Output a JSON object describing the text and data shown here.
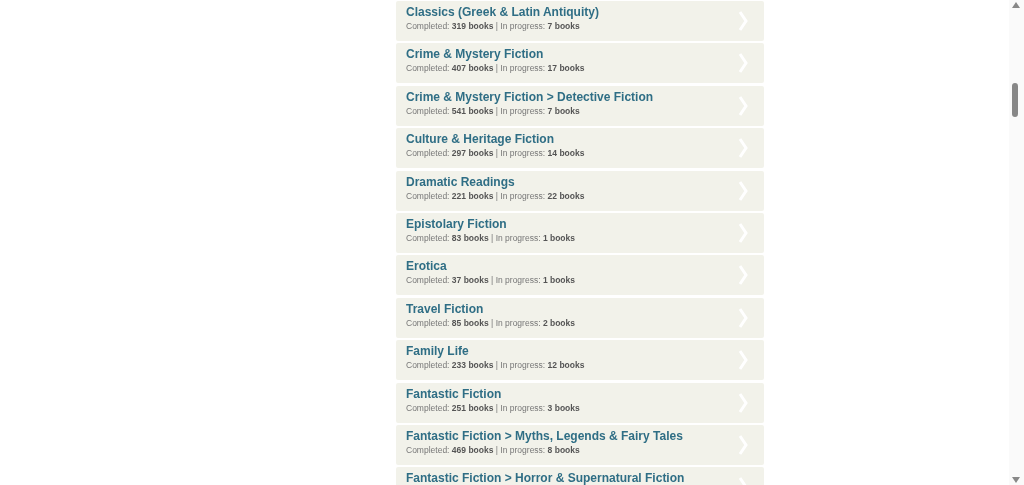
{
  "categories": [
    {
      "title": "Classics (Greek & Latin Antiquity)",
      "stats": "Completed: **319 books** | In progress: **7 books**"
    },
    {
      "title": "Crime & Mystery Fiction",
      "stats": "Completed: **407 books** | In progress: **17 books**"
    },
    {
      "title": "Crime & Mystery Fiction > Detective Fiction",
      "stats": "Completed: **541 books** | In progress: **7 books**"
    },
    {
      "title": "Culture & Heritage Fiction",
      "stats": "Completed: **297 books** | In progress: **14 books**"
    },
    {
      "title": "Dramatic Readings",
      "stats": "Completed: **221 books** | In progress: **22 books**"
    },
    {
      "title": "Epistolary Fiction",
      "stats": "Completed: **83 books** | In progress: **1 books**"
    },
    {
      "title": "Erotica",
      "stats": "Completed: **37 books** | In progress: **1 books**"
    },
    {
      "title": "Travel Fiction",
      "stats": "Completed: **85 books** | In progress: **2 books**"
    },
    {
      "title": "Family Life",
      "stats": "Completed: **233 books** | In progress: **12 books**"
    },
    {
      "title": "Fantastic Fiction",
      "stats": "Completed: **251 books** | In progress: **3 books**"
    },
    {
      "title": "Fantastic Fiction > Myths, Legends & Fairy Tales",
      "stats": "Completed: **469 books** | In progress: **8 books**"
    },
    {
      "title": "Fantastic Fiction > Horror & Supernatural Fiction"
    }
  ]
}
